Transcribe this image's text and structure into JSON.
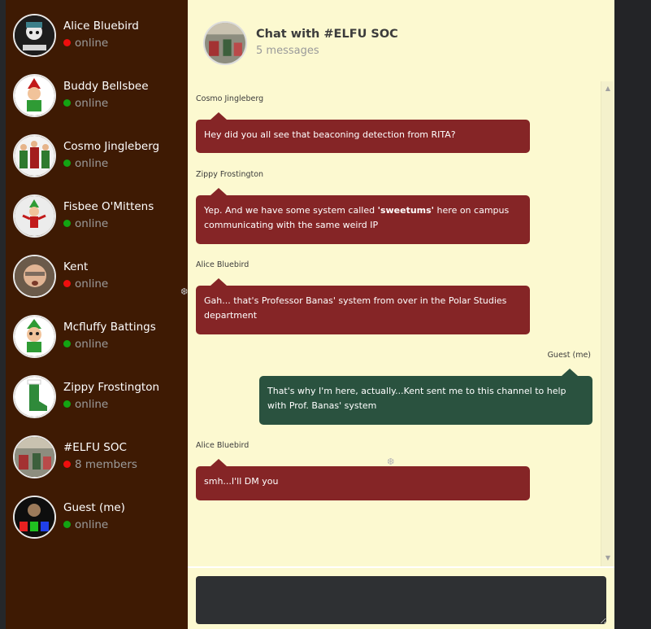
{
  "colors": {
    "online": "#13a313",
    "offline": "#ee0e0e",
    "sidebar_bg": "#3e1a03",
    "chat_bg": "#fcf9d0",
    "bubble_them": "#852526",
    "bubble_me": "#2a523f"
  },
  "contacts": [
    {
      "name": "Alice Bluebird",
      "status": "online",
      "status_color": "red",
      "avatar_icon": "alice-avatar-icon"
    },
    {
      "name": "Buddy Bellsbee",
      "status": "online",
      "status_color": "green",
      "avatar_icon": "elf-avatar-icon"
    },
    {
      "name": "Cosmo Jingleberg",
      "status": "online",
      "status_color": "green",
      "avatar_icon": "elf-group-avatar-icon"
    },
    {
      "name": "Fisbee O'Mittens",
      "status": "online",
      "status_color": "green",
      "avatar_icon": "elf-avatar-icon"
    },
    {
      "name": "Kent",
      "status": "online",
      "status_color": "red",
      "avatar_icon": "kent-avatar-icon"
    },
    {
      "name": "Mcfluffy Battings",
      "status": "online",
      "status_color": "green",
      "avatar_icon": "elf-avatar-icon"
    },
    {
      "name": "Zippy Frostington",
      "status": "online",
      "status_color": "green",
      "avatar_icon": "elf-boot-avatar-icon"
    },
    {
      "name": "#ELFU SOC",
      "status": "8 members",
      "status_color": "red",
      "avatar_icon": "soc-room-avatar-icon"
    },
    {
      "name": "Guest (me)",
      "status": "online",
      "status_color": "green",
      "avatar_icon": "hhc-logo-avatar-icon"
    }
  ],
  "chat": {
    "title": "Chat with #ELFU SOC",
    "subtitle": "5 messages",
    "avatar_icon": "soc-room-avatar-icon"
  },
  "messages": [
    {
      "sender": "Cosmo Jingleberg",
      "side": "them",
      "text_before": "Hey did you all see that beaconing detection from RITA?",
      "bold": "",
      "text_after": ""
    },
    {
      "sender": "Zippy Frostington",
      "side": "them",
      "text_before": "Yep. And we have some system called ",
      "bold": "'sweetums'",
      "text_after": " here on campus communicating with the same weird IP"
    },
    {
      "sender": "Alice Bluebird",
      "side": "them",
      "text_before": "Gah... that's Professor Banas' system from over in the Polar Studies department",
      "bold": "",
      "text_after": ""
    },
    {
      "sender": "Guest (me)",
      "side": "me",
      "text_before": "That's why I'm here, actually...Kent sent me to this channel to help with Prof. Banas' system",
      "bold": "",
      "text_after": ""
    },
    {
      "sender": "Alice Bluebird",
      "side": "them",
      "text_before": "smh...I'll DM you",
      "bold": "",
      "text_after": ""
    }
  ],
  "composer": {
    "value": "",
    "placeholder": ""
  },
  "scrollbar": {
    "up_icon": "scroll-up-arrow-icon",
    "down_icon": "scroll-down-arrow-icon"
  }
}
